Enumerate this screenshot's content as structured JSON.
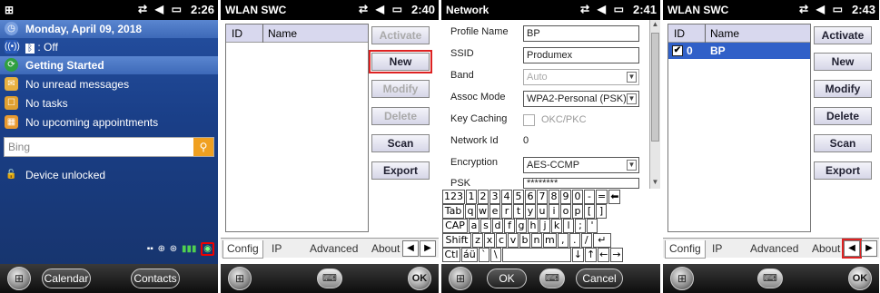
{
  "screen1": {
    "time": "2:26",
    "date": "Monday, April 09, 2018",
    "bluetooth": ": Off",
    "items": [
      {
        "icon": "getting-started-icon",
        "label": "Getting Started"
      },
      {
        "icon": "mail-icon",
        "label": "No unread messages"
      },
      {
        "icon": "tasks-icon",
        "label": "No tasks"
      },
      {
        "icon": "calendar-icon",
        "label": "No upcoming appointments"
      }
    ],
    "search_placeholder": "Bing",
    "device_status": "Device unlocked",
    "softkey_left": "Calendar",
    "softkey_right": "Contacts"
  },
  "screen2": {
    "title": "WLAN SWC",
    "time": "2:40",
    "columns": [
      "ID",
      "Name"
    ],
    "buttons": [
      "Activate",
      "New",
      "Modify",
      "Delete",
      "Scan",
      "Export"
    ],
    "highlighted_button": "New",
    "tabs": [
      "Config",
      "IP",
      "Advanced",
      "About"
    ]
  },
  "screen3": {
    "title": "Network",
    "time": "2:41",
    "fields": {
      "profile_name_label": "Profile Name",
      "profile_name": "BP",
      "ssid_label": "SSID",
      "ssid": "Produmex",
      "band_label": "Band",
      "band": "Auto",
      "assoc_mode_label": "Assoc Mode",
      "assoc_mode": "WPA2-Personal (PSK)",
      "key_caching_label": "Key Caching",
      "key_caching": "OKC/PKC",
      "network_id_label": "Network Id",
      "network_id": "0",
      "encryption_label": "Encryption",
      "encryption": "AES-CCMP",
      "psk_label": "PSK",
      "psk": "********"
    },
    "keyboard": [
      [
        "123",
        "1",
        "2",
        "3",
        "4",
        "5",
        "6",
        "7",
        "8",
        "9",
        "0",
        "-",
        "=",
        "⬅"
      ],
      [
        "Tab",
        "q",
        "w",
        "e",
        "r",
        "t",
        "y",
        "u",
        "i",
        "o",
        "p",
        "[",
        "]"
      ],
      [
        "CAP",
        "a",
        "s",
        "d",
        "f",
        "g",
        "h",
        "j",
        "k",
        "l",
        ";",
        "'"
      ],
      [
        "Shift",
        "z",
        "x",
        "c",
        "v",
        "b",
        "n",
        "m",
        ",",
        ".",
        "/",
        "↵"
      ],
      [
        "Ctl",
        "áü",
        "`",
        "\\",
        "",
        "↓",
        "↑",
        "←",
        "→"
      ]
    ],
    "softkey_ok": "OK",
    "softkey_cancel": "Cancel"
  },
  "screen4": {
    "title": "WLAN SWC",
    "time": "2:43",
    "columns": [
      "ID",
      "Name"
    ],
    "row": {
      "checked": true,
      "id": "0",
      "name": "BP"
    },
    "buttons": [
      "Activate",
      "New",
      "Modify",
      "Delete",
      "Scan",
      "Export"
    ],
    "tabs": [
      "Config",
      "IP",
      "Advanced",
      "About"
    ]
  },
  "ok_label": "OK",
  "colors": {
    "accent": "#3060c8",
    "highlight": "#dd2222",
    "bing": "#f0a020"
  }
}
